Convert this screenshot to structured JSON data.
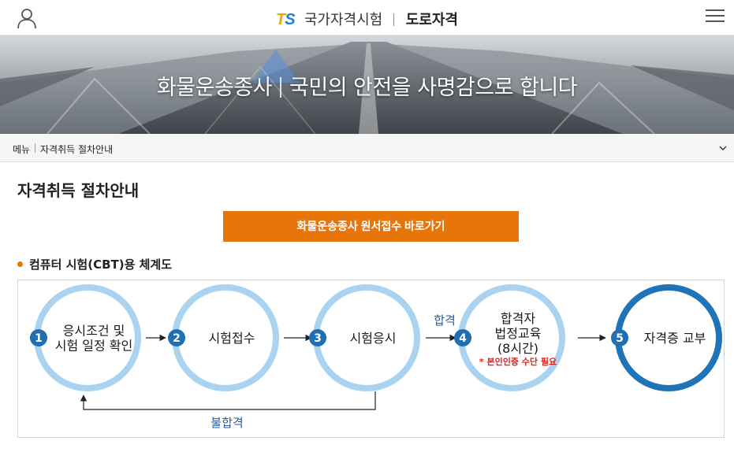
{
  "header": {
    "logo_t": "T",
    "logo_s": "S",
    "org": "국가자격시험",
    "site": "도로자격"
  },
  "hero": {
    "left": "화물운송종사",
    "right": "국민의 안전을 사명감으로 합니다"
  },
  "breadcrumb": {
    "menu": "메뉴",
    "current": "자격취득 절차안내"
  },
  "page": {
    "title": "자격취득 절차안내",
    "cta_label": "화물운송종사 원서접수 바로가기",
    "section_title": "컴퓨터 시험(CBT)용 체계도"
  },
  "flow": {
    "steps": [
      {
        "num": "1",
        "lines": [
          "응시조건 및",
          "시험 일정 확인"
        ]
      },
      {
        "num": "2",
        "lines": [
          "시험접수"
        ]
      },
      {
        "num": "3",
        "lines": [
          "시험응시"
        ]
      },
      {
        "num": "4",
        "lines": [
          "합격자",
          "법정교육",
          "(8시간)"
        ],
        "note": "* 본인인증 수단 필요"
      },
      {
        "num": "5",
        "lines": [
          "자격증 교부"
        ]
      }
    ],
    "pass_label": "합격",
    "fail_label": "불합격"
  },
  "colors": {
    "accent": "#e8750a",
    "ring_light": "#a9d3f0",
    "ring_dark": "#1f73b7",
    "badge": "#1f6fb2",
    "note": "#e0201b"
  }
}
